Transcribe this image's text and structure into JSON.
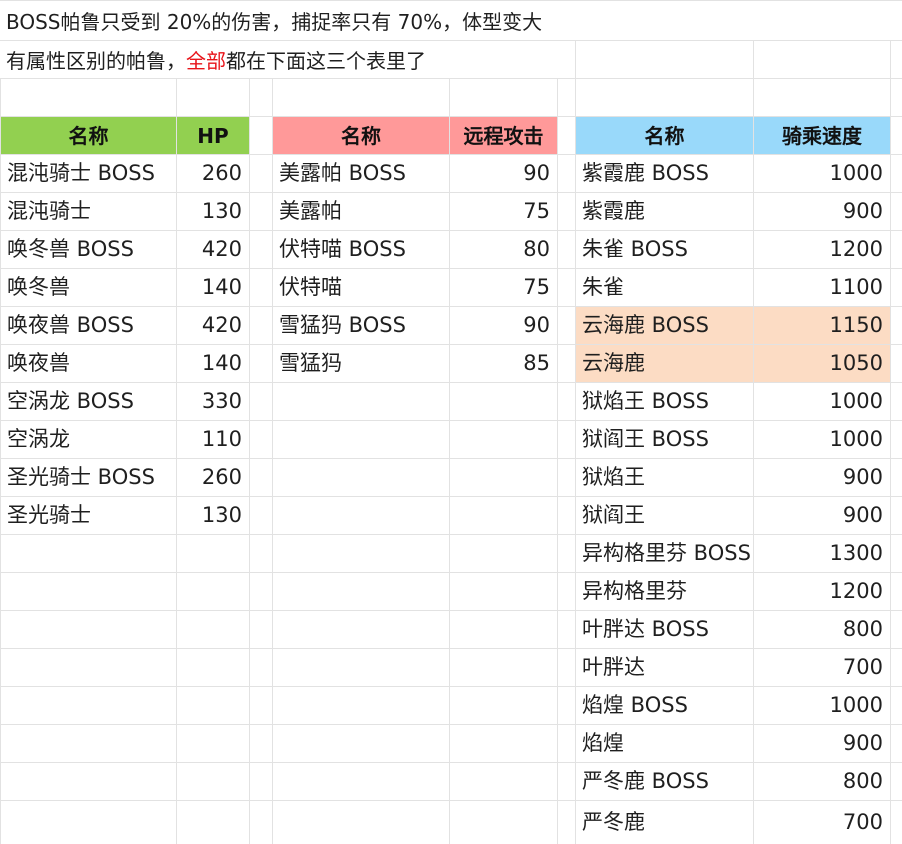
{
  "notes": {
    "line1": "BOSS帕鲁只受到 20%的伤害，捕捉率只有 70%，体型变大",
    "line2_pre": "有属性区别的帕鲁，",
    "line2_highlight": "全部",
    "line2_post": "都在下面这三个表里了"
  },
  "colors": {
    "grid": "#e2e2e2",
    "hp_header": "#92d050",
    "ranged_header": "#ff9999",
    "speed_header": "#99d9fa",
    "highlight_row": "#fcdcc4",
    "highlight_text": "#e8141a"
  },
  "tables": {
    "hp": {
      "headers": [
        "名称",
        "HP"
      ],
      "rows": [
        [
          "混沌骑士 BOSS",
          "260"
        ],
        [
          "混沌骑士",
          "130"
        ],
        [
          "唤冬兽 BOSS",
          "420"
        ],
        [
          "唤冬兽",
          "140"
        ],
        [
          "唤夜兽 BOSS",
          "420"
        ],
        [
          "唤夜兽",
          "140"
        ],
        [
          "空涡龙 BOSS",
          "330"
        ],
        [
          "空涡龙",
          "110"
        ],
        [
          "圣光骑士 BOSS",
          "260"
        ],
        [
          "圣光骑士",
          "130"
        ]
      ]
    },
    "ranged": {
      "headers": [
        "名称",
        "远程攻击"
      ],
      "rows": [
        [
          "美露帕 BOSS",
          "90"
        ],
        [
          "美露帕",
          "75"
        ],
        [
          "伏特喵 BOSS",
          "80"
        ],
        [
          "伏特喵",
          "75"
        ],
        [
          "雪猛犸 BOSS",
          "90"
        ],
        [
          "雪猛犸",
          "85"
        ]
      ]
    },
    "speed": {
      "headers": [
        "名称",
        "骑乘速度"
      ],
      "highlighted_rows": [
        4,
        5
      ],
      "rows": [
        [
          "紫霞鹿 BOSS",
          "1000"
        ],
        [
          "紫霞鹿",
          "900"
        ],
        [
          "朱雀 BOSS",
          "1200"
        ],
        [
          "朱雀",
          "1100"
        ],
        [
          "云海鹿 BOSS",
          "1150"
        ],
        [
          "云海鹿",
          "1050"
        ],
        [
          "狱焰王 BOSS",
          "1000"
        ],
        [
          "狱阎王 BOSS",
          "1000"
        ],
        [
          "狱焰王",
          "900"
        ],
        [
          "狱阎王",
          "900"
        ],
        [
          "异构格里芬 BOSS",
          "1300"
        ],
        [
          "异构格里芬",
          "1200"
        ],
        [
          "叶胖达 BOSS",
          "800"
        ],
        [
          "叶胖达",
          "700"
        ],
        [
          "焰煌 BOSS",
          "1000"
        ],
        [
          "焰煌",
          "900"
        ],
        [
          "严冬鹿 BOSS",
          "800"
        ],
        [
          "严冬鹿",
          "700"
        ]
      ]
    }
  }
}
